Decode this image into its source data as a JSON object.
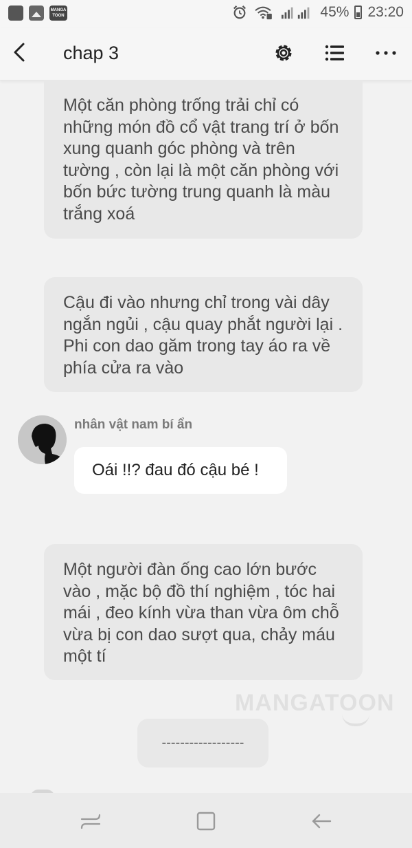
{
  "status_bar": {
    "logo_text": "MANGA TOON",
    "battery": "45%",
    "time": "23:20",
    "icons": [
      "notification-icon",
      "image-icon",
      "mangatoon-app-icon",
      "alarm-icon",
      "wifi-icon",
      "signal-icon",
      "battery-icon"
    ]
  },
  "app_bar": {
    "title": "chap 3",
    "icons": [
      "back-arrow-icon",
      "settings-icon",
      "list-icon",
      "more-icon"
    ]
  },
  "content": {
    "narration_1": "Một căn phòng trống trải chỉ có những món đồ cổ vật trang trí ở bốn xung quanh góc phòng và trên tường , còn lại là một căn phòng với bốn bức tường trung quanh là màu trắng xoá",
    "narration_2": "Cậu đi vào nhưng chỉ trong vài dây ngắn ngủi , cậu quay phắt người lại . Phi con dao găm trong tay áo ra về phía cửa ra vào",
    "speaker_name": "nhân vật nam bí ẩn",
    "speech": "Oái !!? đau đó cậu bé !",
    "narration_3": "Một người đàn ống cao lớn bước vào , mặc bộ đồ thí nghiệm , tóc hai mái , đeo kính vừa than vừa ôm chỗ vừa bị con dao sượt qua, chảy máu một tí",
    "divider": "------------------",
    "watermark": "MANGATOON"
  },
  "nav_bar": {
    "icons": [
      "recent-apps-icon",
      "home-icon",
      "back-icon"
    ]
  },
  "colors": {
    "background": "#f2f2f2",
    "narration_bubble": "#e8e8e8",
    "speech_bubble": "#ffffff",
    "navbar": "#ebebeb"
  }
}
